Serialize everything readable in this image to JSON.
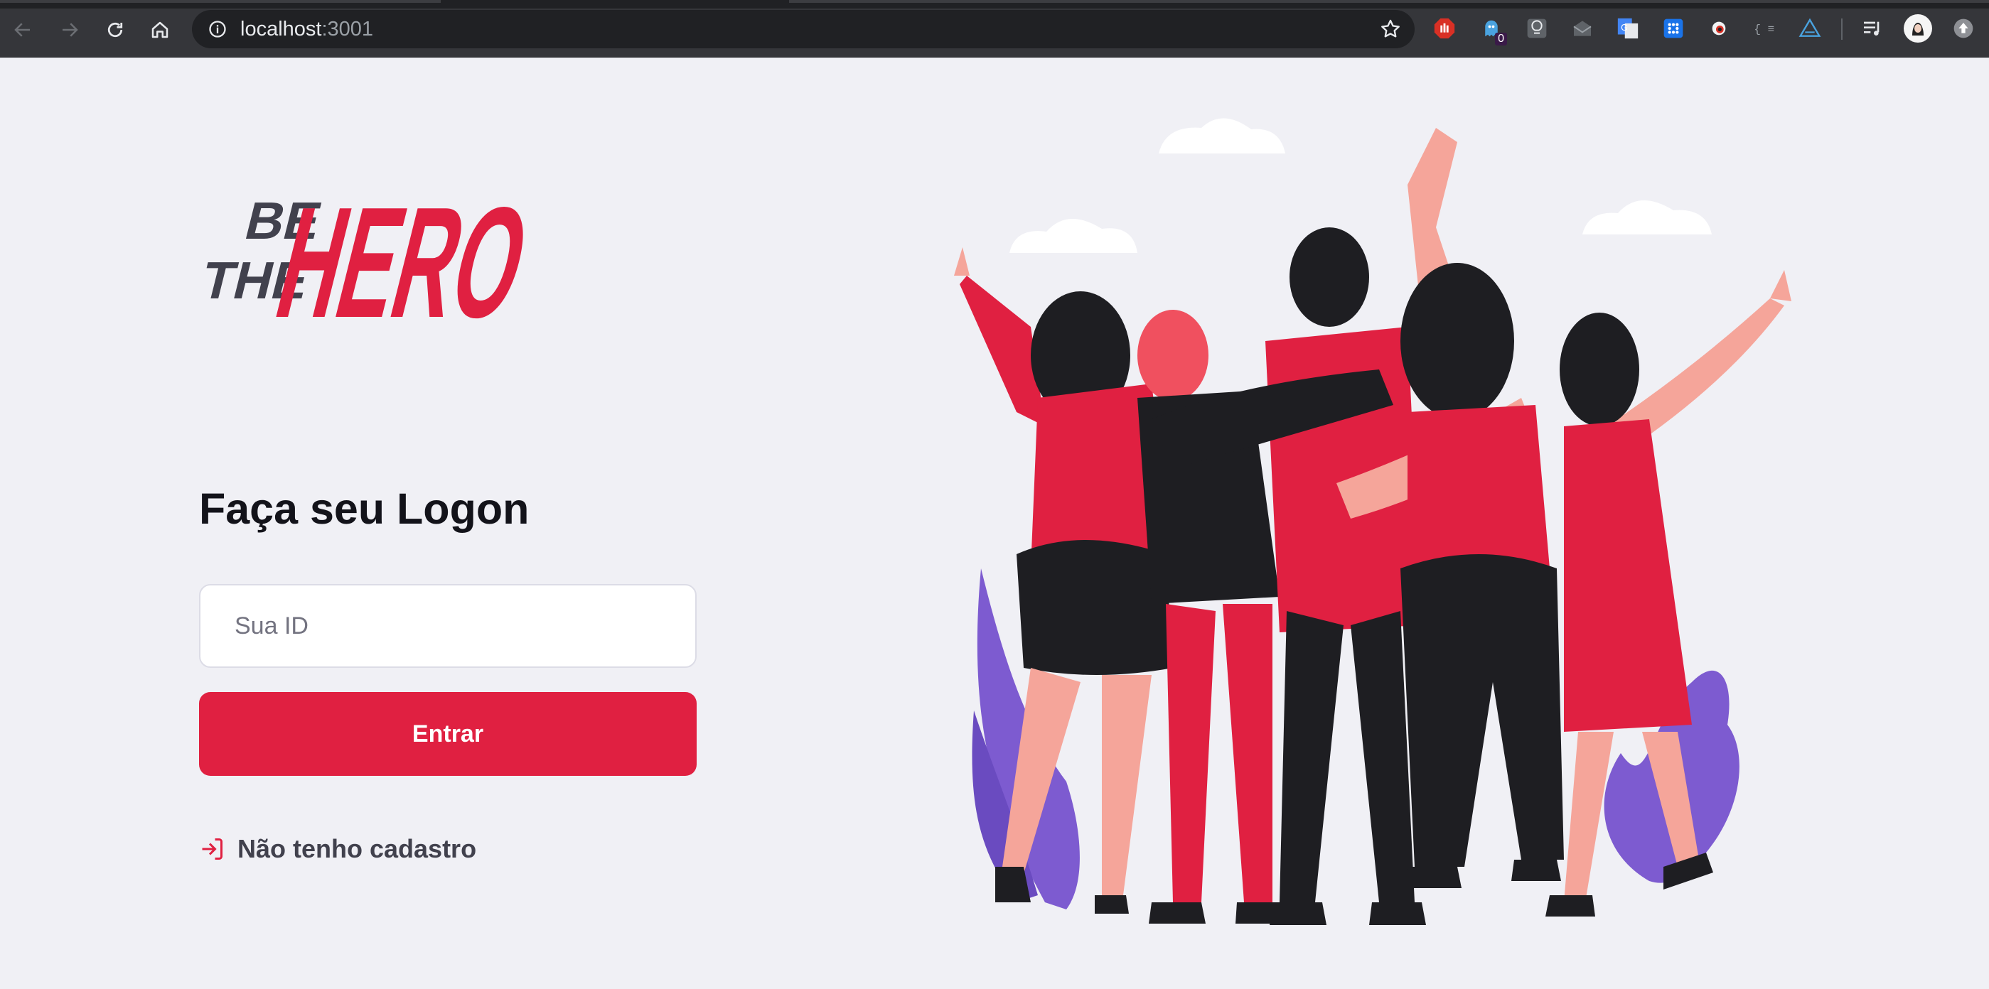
{
  "browser": {
    "url_host": "localhost",
    "url_port": ":3001",
    "extension_badge": "0"
  },
  "logo": {
    "be": "BE",
    "the": "THE",
    "hero": "HERO"
  },
  "logon": {
    "title": "Faça seu Logon",
    "id_placeholder": "Sua ID",
    "enter_label": "Entrar",
    "register_link": "Não tenho cadastro"
  },
  "colors": {
    "brand_red": "#e02041",
    "background": "#f0f0f5",
    "text_dark": "#13131a",
    "leaf_purple": "#7d5bd0"
  },
  "icons": {
    "back": "arrow-left-icon",
    "forward": "arrow-right-icon",
    "reload": "reload-icon",
    "home": "home-icon",
    "site_info": "info-icon",
    "bookmark": "star-icon",
    "register": "log-in-icon"
  }
}
